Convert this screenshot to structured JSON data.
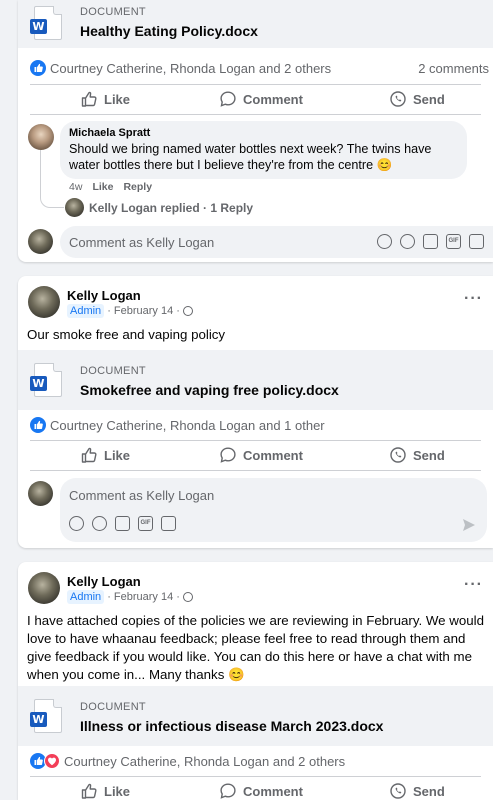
{
  "post1": {
    "doc_label": "DOCUMENT",
    "doc_name": "Healthy Eating Policy.docx",
    "reactions": "Courtney Catherine, Rhonda Logan and 2 others",
    "comments_count": "2 comments",
    "actions": {
      "like": "Like",
      "comment": "Comment",
      "send": "Send"
    },
    "comment": {
      "author": "Michaela Spratt",
      "text": "Should we bring named water bottles next week? The twins have water bottles there but I believe they're from the centre 😊",
      "age": "4w",
      "like": "Like",
      "reply": "Reply"
    },
    "replies": "Kelly Logan replied · 1 Reply",
    "comment_placeholder": "Comment as Kelly Logan"
  },
  "post2": {
    "author": "Kelly Logan",
    "badge": "Admin",
    "date": "· February 14 ·",
    "text": "Our smoke free and vaping policy",
    "doc_label": "DOCUMENT",
    "doc_name": "Smokefree and vaping free policy.docx",
    "reactions": "Courtney Catherine, Rhonda Logan and 1 other",
    "actions": {
      "like": "Like",
      "comment": "Comment",
      "send": "Send"
    },
    "comment_placeholder": "Comment as Kelly Logan"
  },
  "post3": {
    "author": "Kelly Logan",
    "badge": "Admin",
    "date": "· February 14 ·",
    "text": "I have attached copies of the policies we are reviewing in February.  We would love to have whaanau feedback; please feel free to read through them and give feedback if you would like.  You can do this here or have a chat with me when you come in... Many thanks 😊",
    "doc_label": "DOCUMENT",
    "doc_name": "Illness or infectious disease March 2023.docx",
    "reactions": "Courtney Catherine, Rhonda Logan and 2 others",
    "actions": {
      "like": "Like",
      "comment": "Comment",
      "send": "Send"
    }
  },
  "colors": {
    "facebook_blue": "#1877f2",
    "word_blue": "#185abd",
    "love_red": "#f33e58"
  },
  "icons": [
    "word-doc-icon",
    "like-reaction-icon",
    "love-reaction-icon",
    "thumbs-up-icon",
    "comment-bubble-icon",
    "send-icon",
    "globe-icon",
    "more-dots-icon",
    "avatar-sticker-icon",
    "emoji-icon",
    "camera-icon",
    "gif-icon",
    "sticker-icon",
    "send-arrow-icon"
  ]
}
